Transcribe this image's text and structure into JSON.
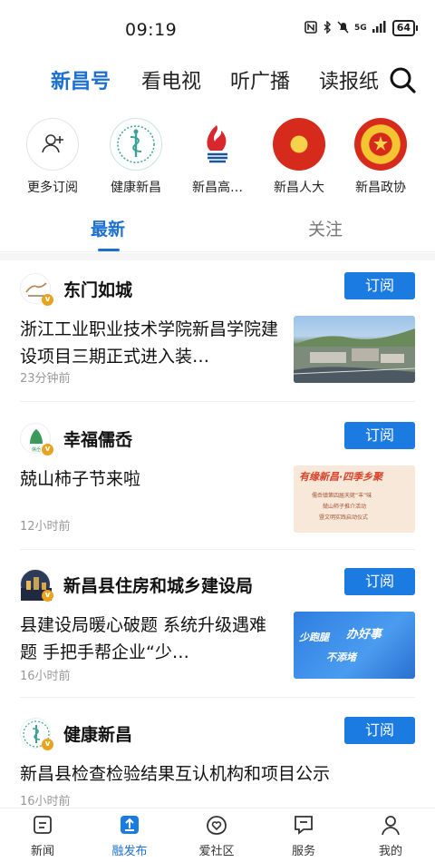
{
  "status_bar": {
    "time": "09:19",
    "network": "5G",
    "battery": "64"
  },
  "channel_tabs": [
    {
      "label": "新昌号",
      "active": true
    },
    {
      "label": "看电视",
      "active": false
    },
    {
      "label": "听广播",
      "active": false
    },
    {
      "label": "读报纸",
      "active": false
    }
  ],
  "subscriptions": [
    {
      "label": "更多订阅",
      "icon": "add-user-icon"
    },
    {
      "label": "健康新昌",
      "icon": "health-logo-icon"
    },
    {
      "label": "新昌高…",
      "icon": "fire-logo-icon"
    },
    {
      "label": "新昌人大",
      "icon": "national-emblem-icon"
    },
    {
      "label": "新昌政协",
      "icon": "cppcc-emblem-icon"
    }
  ],
  "feed_tabs": [
    {
      "label": "最新",
      "active": true
    },
    {
      "label": "关注",
      "active": false
    }
  ],
  "articles": [
    {
      "author": "东门如城",
      "subscribe_label": "订阅",
      "title": "浙江工业职业技术学院新昌学院建设项目三期正式进入装…",
      "time": "23分钟前"
    },
    {
      "author": "幸福儒岙",
      "subscribe_label": "订阅",
      "title": "兢山柿子节来啦",
      "time": "12小时前",
      "thumb_text": {
        "headline": "有缘新昌·四季乡聚",
        "line1": "儒岙镇第四届天姥“丰”味",
        "line2": "兢山柿子推介活动",
        "line3": "暨文明实践启动仪式"
      }
    },
    {
      "author": "新昌县住房和城乡建设局",
      "subscribe_label": "订阅",
      "title": "县建设局暖心破题 系统升级遇难题 手把手帮企业“少…",
      "time": "16小时前",
      "thumb_text": {
        "part1": "少跑腿",
        "part2": "办好事",
        "part3": "不添堵"
      }
    },
    {
      "author": "健康新昌",
      "subscribe_label": "订阅",
      "title": "新昌县检查检验结果互认机构和项目公示",
      "time": "16小时前"
    }
  ],
  "bottom_nav": [
    {
      "label": "新闻",
      "icon": "news-icon",
      "active": false
    },
    {
      "label": "融发布",
      "icon": "publish-icon",
      "active": true
    },
    {
      "label": "爱社区",
      "icon": "community-icon",
      "active": false
    },
    {
      "label": "服务",
      "icon": "service-icon",
      "active": false
    },
    {
      "label": "我的",
      "icon": "profile-icon",
      "active": false
    }
  ],
  "colors": {
    "accent": "#1b6fd1",
    "button": "#1b7be0",
    "badge": "#e8a320"
  }
}
